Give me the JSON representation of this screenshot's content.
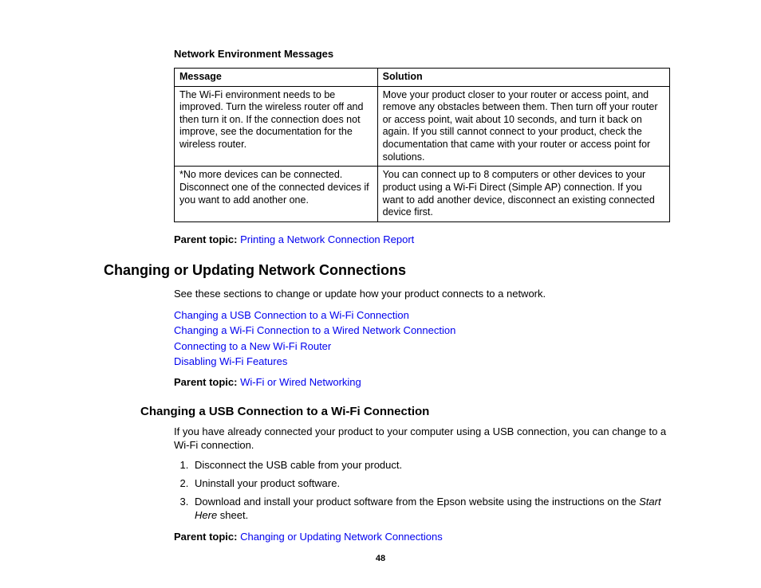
{
  "tableTitle": "Network Environment Messages",
  "table": {
    "headers": {
      "message": "Message",
      "solution": "Solution"
    },
    "rows": [
      {
        "message": "The Wi-Fi environment needs to be improved. Turn the wireless router off and then turn it on. If the connection does not improve, see the documentation for the wireless router.",
        "solution": "Move your product closer to your router or access point, and remove any obstacles between them. Then turn off your router or access point, wait about 10 seconds, and turn it back on again. If you still cannot connect to your product, check the documentation that came with your router or access point for solutions."
      },
      {
        "message": "*No more devices can be connected. Disconnect one of the connected devices if you want to add another one.",
        "solution": "You can connect up to 8 computers or other devices to your product using a Wi-Fi Direct (Simple AP) connection. If you want to add another device, disconnect an existing connected device first."
      }
    ]
  },
  "parentTopic1": {
    "label": "Parent topic: ",
    "link": "Printing a Network Connection Report"
  },
  "section": {
    "heading": "Changing or Updating Network Connections",
    "intro": "See these sections to change or update how your product connects to a network.",
    "links": [
      "Changing a USB Connection to a Wi-Fi Connection",
      "Changing a Wi-Fi Connection to a Wired Network Connection",
      "Connecting to a New Wi-Fi Router",
      "Disabling Wi-Fi Features"
    ],
    "parentTopic": {
      "label": "Parent topic: ",
      "link": "Wi-Fi or Wired Networking"
    }
  },
  "subsection": {
    "heading": "Changing a USB Connection to a Wi-Fi Connection",
    "intro": "If you have already connected your product to your computer using a USB connection, you can change to a Wi-Fi connection.",
    "steps": [
      "Disconnect the USB cable from your product.",
      "Uninstall your product software.",
      {
        "pre": "Download and install your product software from the Epson website using the instructions on the ",
        "italic": "Start Here",
        "post": " sheet."
      }
    ],
    "parentTopic": {
      "label": "Parent topic: ",
      "link": "Changing or Updating Network Connections"
    }
  },
  "pageNumber": "48"
}
